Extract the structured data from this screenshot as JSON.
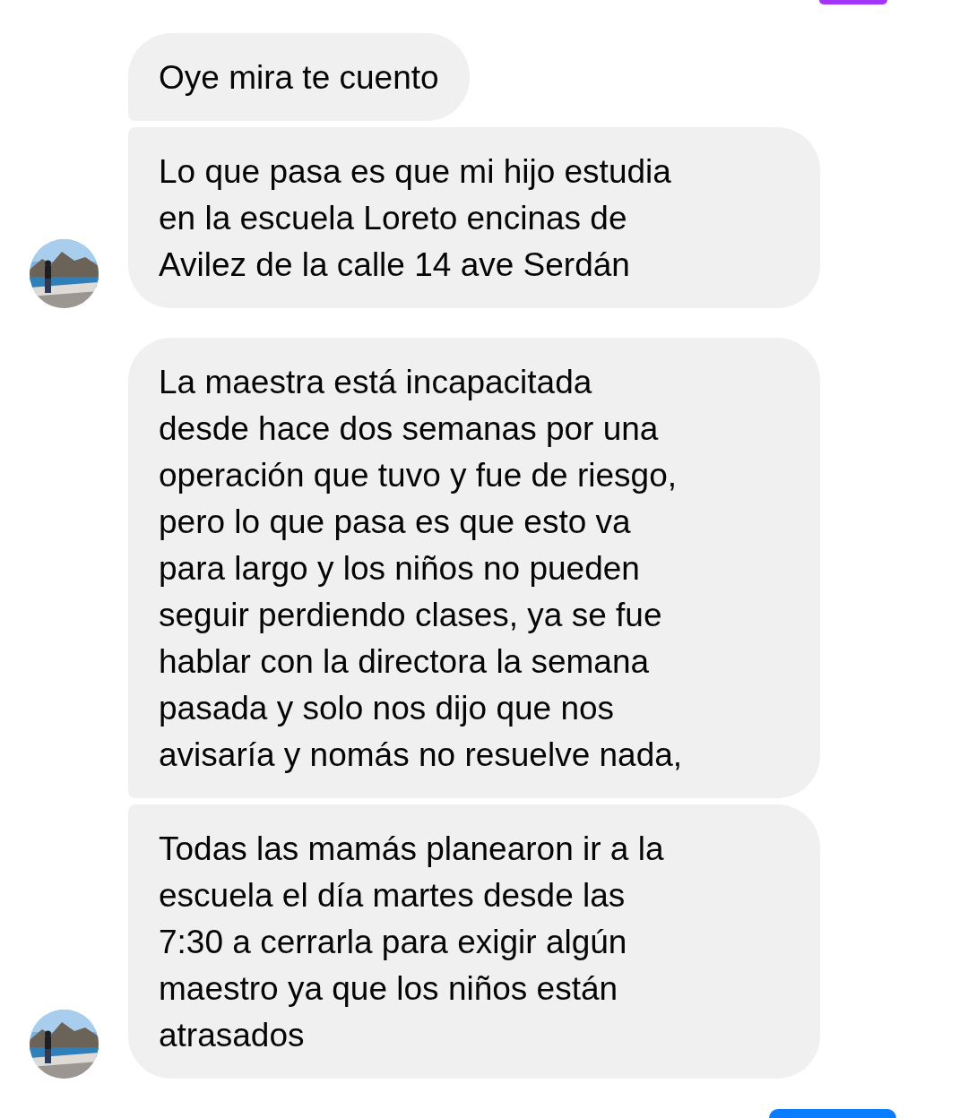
{
  "groups": [
    {
      "messages": [
        {
          "lines": [
            "Oye mira te cuento"
          ]
        },
        {
          "lines": [
            "Lo que pasa es que mi hijo estudia",
            "en la escuela Loreto encinas de",
            "Avilez de la calle 14 ave Serdán"
          ]
        }
      ]
    },
    {
      "messages": [
        {
          "lines": [
            "La maestra está incapacitada",
            "desde hace dos semanas por una",
            "operación que tuvo y fue de riesgo,",
            "pero lo que pasa es que esto va",
            "para largo y los niños no pueden",
            "seguir perdiendo clases, ya se fue",
            "hablar con la directora la semana",
            "pasada y solo nos dijo que nos",
            "avisaría y nomás no resuelve nada,"
          ]
        },
        {
          "lines": [
            "Todas las mamás planearon ir a la",
            "escuela el día martes desde las",
            "7:30 a cerrarla para exigir algún",
            "maestro ya que los niños están",
            "atrasados"
          ]
        }
      ]
    }
  ]
}
